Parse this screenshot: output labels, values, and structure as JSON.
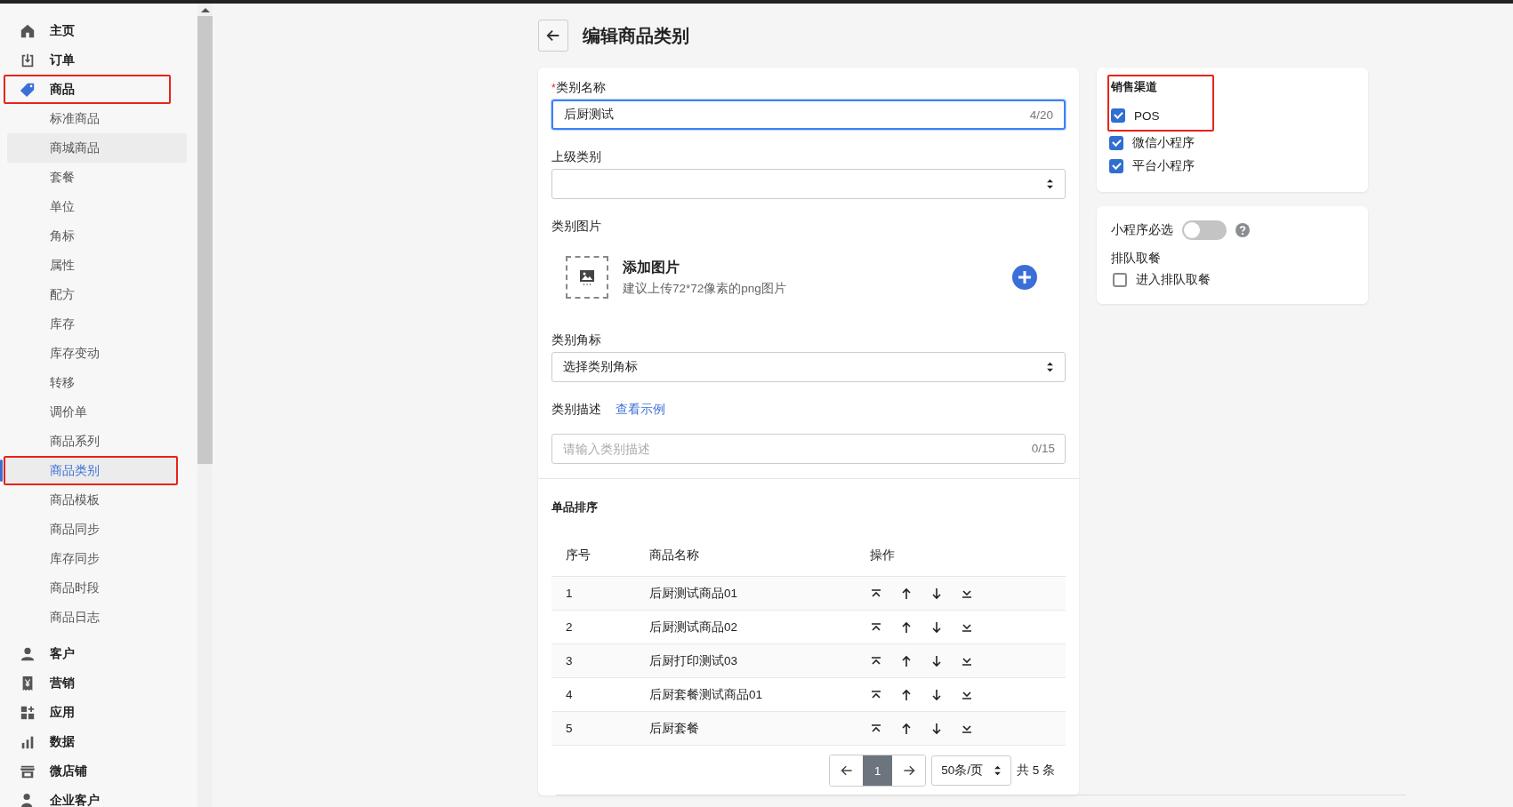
{
  "sidebar": {
    "items": [
      {
        "label": "主页",
        "highlighted": false
      },
      {
        "label": "订单",
        "highlighted": false
      },
      {
        "label": "商品",
        "highlighted": true,
        "children": [
          {
            "label": "标准商品",
            "selected": false,
            "hovered": false,
            "highlighted": false
          },
          {
            "label": "商城商品",
            "selected": false,
            "hovered": true,
            "highlighted": false
          },
          {
            "label": "套餐",
            "selected": false,
            "hovered": false,
            "highlighted": false
          },
          {
            "label": "单位",
            "selected": false,
            "hovered": false,
            "highlighted": false
          },
          {
            "label": "角标",
            "selected": false,
            "hovered": false,
            "highlighted": false
          },
          {
            "label": "属性",
            "selected": false,
            "hovered": false,
            "highlighted": false
          },
          {
            "label": "配方",
            "selected": false,
            "hovered": false,
            "highlighted": false
          },
          {
            "label": "库存",
            "selected": false,
            "hovered": false,
            "highlighted": false
          },
          {
            "label": "库存变动",
            "selected": false,
            "hovered": false,
            "highlighted": false
          },
          {
            "label": "转移",
            "selected": false,
            "hovered": false,
            "highlighted": false
          },
          {
            "label": "调价单",
            "selected": false,
            "hovered": false,
            "highlighted": false
          },
          {
            "label": "商品系列",
            "selected": false,
            "hovered": false,
            "highlighted": false
          },
          {
            "label": "商品类别",
            "selected": true,
            "hovered": false,
            "highlighted": true
          },
          {
            "label": "商品模板",
            "selected": false,
            "hovered": false,
            "highlighted": false
          },
          {
            "label": "商品同步",
            "selected": false,
            "hovered": false,
            "highlighted": false
          },
          {
            "label": "库存同步",
            "selected": false,
            "hovered": false,
            "highlighted": false
          },
          {
            "label": "商品时段",
            "selected": false,
            "hovered": false,
            "highlighted": false
          },
          {
            "label": "商品日志",
            "selected": false,
            "hovered": false,
            "highlighted": false
          }
        ]
      },
      {
        "label": "客户",
        "highlighted": false
      },
      {
        "label": "营销",
        "highlighted": false
      },
      {
        "label": "应用",
        "highlighted": false
      },
      {
        "label": "数据",
        "highlighted": false
      },
      {
        "label": "微店铺",
        "highlighted": false
      },
      {
        "label": "企业客户",
        "highlighted": false
      }
    ]
  },
  "page": {
    "title": "编辑商品类别"
  },
  "form": {
    "name": {
      "required_mark": "*",
      "label": "类别名称",
      "value": "后厨测试",
      "counter": "4/20",
      "focused": true
    },
    "parent": {
      "label": "上级类别"
    },
    "image": {
      "label": "类别图片",
      "title": "添加图片",
      "hint": "建议上传72*72像素的png图片"
    },
    "badge": {
      "label": "类别角标",
      "value": "选择类别角标"
    },
    "description": {
      "label": "类别描述",
      "link": "查看示例",
      "placeholder": "请输入类别描述",
      "counter": "0/15"
    }
  },
  "sorting": {
    "title": "单品排序",
    "columns": [
      "序号",
      "商品名称",
      "操作"
    ],
    "rows": [
      {
        "index": "1",
        "name": "后厨测试商品01"
      },
      {
        "index": "2",
        "name": "后厨测试商品02"
      },
      {
        "index": "3",
        "name": "后厨打印测试03"
      },
      {
        "index": "4",
        "name": "后厨套餐测试商品01"
      },
      {
        "index": "5",
        "name": "后厨套餐"
      }
    ],
    "pagination": {
      "pages": [
        {
          "label": "1",
          "selected": true
        }
      ],
      "page_size": "50条/页",
      "total": "共 5 条"
    }
  },
  "sales_channels": {
    "title": "销售渠道",
    "highlighted": true,
    "options": [
      {
        "label": "POS",
        "checked": true
      },
      {
        "label": "微信小程序",
        "checked": true
      },
      {
        "label": "平台小程序",
        "checked": true
      }
    ]
  },
  "settings": {
    "required_toggle": {
      "label": "小程序必选",
      "on": false
    },
    "queue_title": "排队取餐",
    "queue_option": {
      "label": "进入排队取餐",
      "checked": false
    }
  }
}
